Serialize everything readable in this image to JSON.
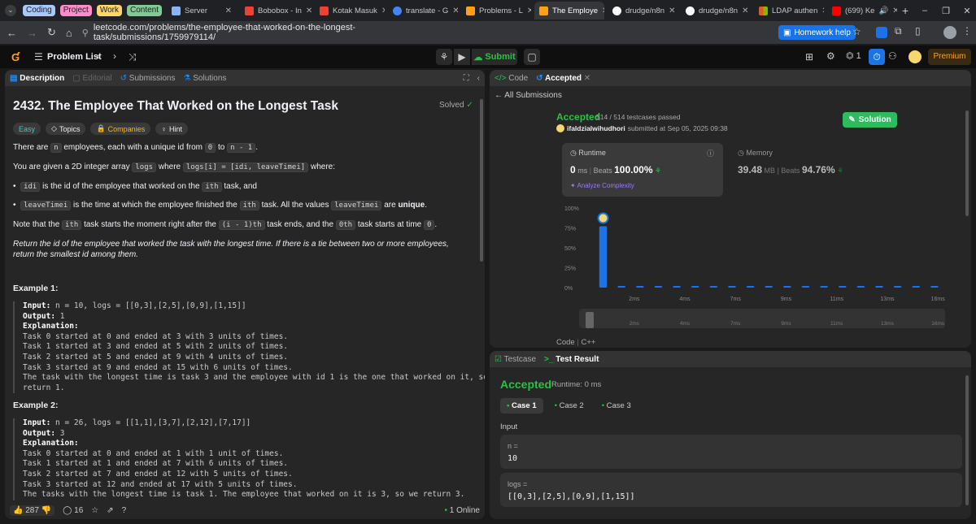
{
  "browser": {
    "groups": [
      {
        "label": "Coding",
        "color": "#a8c7fa"
      },
      {
        "label": "Project",
        "color": "#ff8bcb"
      },
      {
        "label": "Work",
        "color": "#fdd663"
      },
      {
        "label": "Content",
        "color": "#81c995"
      }
    ],
    "tabs": [
      {
        "label": "Server",
        "icon": "apps-icon",
        "color": "#8ab4f8"
      },
      {
        "label": "Bobobox - In",
        "icon": "gmail-icon",
        "color": "#ea4335"
      },
      {
        "label": "Kotak Masuk",
        "icon": "gmail-icon",
        "color": "#ea4335"
      },
      {
        "label": "translate - G",
        "icon": "google-icon",
        "color": "#4285f4"
      },
      {
        "label": "Problems - L",
        "icon": "leetcode-icon",
        "color": "#ffa116"
      },
      {
        "label": "The Employe",
        "icon": "leetcode-icon",
        "color": "#ffa116",
        "active": true
      },
      {
        "label": "drudge/n8n",
        "icon": "github-icon",
        "color": "#ffffff"
      },
      {
        "label": "drudge/n8n",
        "icon": "github-icon",
        "color": "#ffffff"
      },
      {
        "label": "LDAP authen",
        "icon": "microsoft-icon",
        "color": "#f25022"
      },
      {
        "label": "(699) Ke",
        "icon": "youtube-icon",
        "color": "#ff0000"
      }
    ],
    "url": "leetcode.com/problems/the-employee-that-worked-on-the-longest-task/submissions/1759979114/",
    "homework_label": "Homework help"
  },
  "lc": {
    "problem_list": "Problem List",
    "submit": "Submit",
    "premium": "Premium",
    "streak": "1"
  },
  "left": {
    "tabs": [
      "Description",
      "Editorial",
      "Submissions",
      "Solutions"
    ],
    "title": "2432. The Employee That Worked on the Longest Task",
    "solved": "Solved",
    "chips": [
      "Easy",
      "Topics",
      "Companies",
      "Hint"
    ],
    "p1a": "There are",
    "p1n": "n",
    "p1b": "employees, each with a unique id from",
    "p1c": "0",
    "p1d": "to",
    "p1e": "n - 1",
    "p2a": "You are given a 2D integer array",
    "p2b": "logs",
    "p2c": "where",
    "p2d": "logs[i] = [idi, leaveTimei]",
    "p2e": "where:",
    "b1a": "idi",
    "b1b": "is the id of the employee that worked on the",
    "b1c": "ith",
    "b1d": "task, and",
    "b2a": "leaveTimei",
    "b2b": "is the time at which the employee finished the",
    "b2c": "ith",
    "b2d": "task. All the values",
    "b2e": "leaveTimei",
    "b2f": "are",
    "b2g": "unique",
    "p3a": "Note that the",
    "p3b": "ith",
    "p3c": "task starts the moment right after the",
    "p3d": "(i - 1)th",
    "p3e": "task ends, and the",
    "p3f": "0th",
    "p3g": "task starts at time",
    "p3h": "0",
    "p4": "Return the id of the employee that worked the task with the longest time. If there is a tie between two or more employees, return the smallest id among them.",
    "ex1_title": "Example 1:",
    "ex1": [
      "Input: n = 10, logs = [[0,3],[2,5],[0,9],[1,15]]",
      "Output: 1",
      "Explanation:",
      "Task 0 started at 0 and ended at 3 with 3 units of times.",
      "Task 1 started at 3 and ended at 5 with 2 units of times.",
      "Task 2 started at 5 and ended at 9 with 4 units of times.",
      "Task 3 started at 9 and ended at 15 with 6 units of times.",
      "The task with the longest time is task 3 and the employee with id 1 is the one that worked on it, so we",
      "return 1."
    ],
    "ex2_title": "Example 2:",
    "ex2": [
      "Input: n = 26, logs = [[1,1],[3,7],[2,12],[7,17]]",
      "Output: 3",
      "Explanation:",
      "Task 0 started at 0 and ended at 1 with 1 unit of times.",
      "Task 1 started at 1 and ended at 7 with 6 units of times.",
      "Task 2 started at 7 and ended at 12 with 5 units of times.",
      "Task 3 started at 12 and ended at 17 with 5 units of times.",
      "The tasks with the longest time is task 1. The employee that worked on it is 3, so we return 3."
    ],
    "likes": "287",
    "comments": "16",
    "online": "1 Online"
  },
  "right": {
    "tabs": [
      "Code",
      "Accepted"
    ],
    "all_submissions": "All Submissions",
    "status": "Accepted",
    "passed": "514 / 514 testcases passed",
    "user": "ifaldzialwihudhori",
    "submitted": "submitted at Sep 05, 2025 09:38",
    "solution": "Solution",
    "runtime_label": "Runtime",
    "runtime_val": "0",
    "runtime_unit": "ms",
    "beats": "Beats",
    "runtime_beats": "100.00%",
    "analyze": "Analyze Complexity",
    "memory_label": "Memory",
    "memory_val": "39.48",
    "memory_unit": "MB",
    "memory_beats": "94.76%",
    "yticks": [
      "100%",
      "75%",
      "50%",
      "25%",
      "0%"
    ],
    "xticks": [
      "2ms",
      "4ms",
      "7ms",
      "9ms",
      "11ms",
      "13ms",
      "16ms"
    ],
    "code_lang_a": "Code",
    "code_lang_b": "C++"
  },
  "chart_data": {
    "type": "bar",
    "yticks": [
      "100%",
      "75%",
      "50%",
      "25%",
      "0%"
    ],
    "xticks": [
      "2ms",
      "4ms",
      "7ms",
      "9ms",
      "11ms",
      "13ms",
      "16ms"
    ],
    "values": [
      77,
      1,
      1,
      1,
      1,
      1,
      1,
      1,
      1,
      1,
      1,
      1,
      1,
      1,
      1,
      1,
      1,
      1,
      1
    ],
    "ylim": [
      0,
      100
    ]
  },
  "bottom": {
    "tabs": [
      "Testcase",
      "Test Result"
    ],
    "status": "Accepted",
    "runtime": "Runtime: 0 ms",
    "cases": [
      "Case 1",
      "Case 2",
      "Case 3"
    ],
    "input": "Input",
    "n_label": "n =",
    "n_val": "10",
    "logs_label": "logs =",
    "logs_val": "[[0,3],[2,5],[0,9],[1,15]]"
  }
}
